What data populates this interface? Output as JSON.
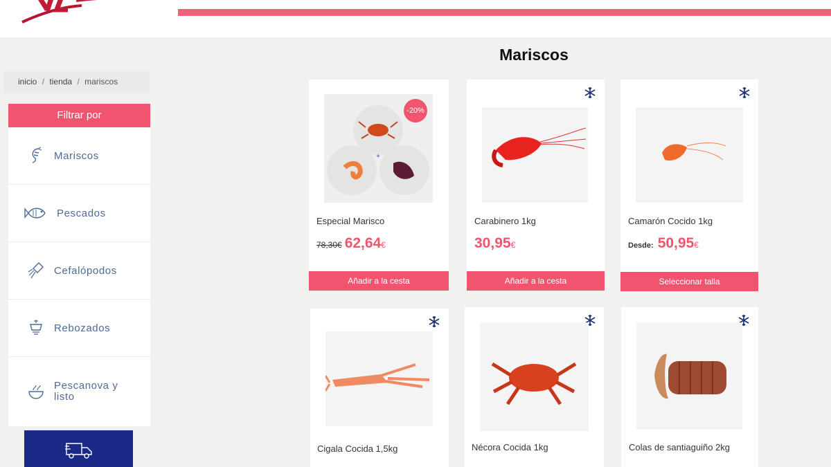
{
  "colors": {
    "accent": "#f1546f",
    "nav_text": "#4d6a98",
    "snow": "#1d2d7a",
    "delivery_bg": "#1a2a86"
  },
  "breadcrumb": {
    "home": "inicio",
    "shop": "tienda",
    "current": "mariscos",
    "separator": "/"
  },
  "sidebar": {
    "filter_title": "Filtrar por",
    "categories": [
      {
        "label": "Mariscos",
        "icon": "shrimp-icon"
      },
      {
        "label": "Pescados",
        "icon": "fish-icon"
      },
      {
        "label": "Cefalópodos",
        "icon": "squid-icon"
      },
      {
        "label": "Rebozados",
        "icon": "fryer-icon"
      },
      {
        "label": "Pescanova y listo",
        "icon": "bowl-icon"
      }
    ],
    "delivery_icon": "delivery-truck-icon"
  },
  "main": {
    "title": "Mariscos",
    "products": [
      {
        "name": "Especial Marisco",
        "old_price": "78,30€",
        "price": "62,64",
        "currency": "€",
        "badge": "-20%",
        "button": "Añadir a la cesta",
        "frozen": false
      },
      {
        "name": "Carabinero 1kg",
        "price": "30,95",
        "currency": "€",
        "button": "Añadir a la cesta",
        "frozen": true
      },
      {
        "name": "Camarón Cocido 1kg",
        "price_prefix": "Desde:",
        "price": "50,95",
        "currency": "€",
        "button": "Seleccionar talla",
        "frozen": true
      },
      {
        "name": "Cigala Cocida 1,5kg",
        "frozen": true
      },
      {
        "name": "Nécora Cocida 1kg",
        "frozen": true
      },
      {
        "name": "Colas de santiaguiño 2kg",
        "frozen": true
      }
    ]
  }
}
